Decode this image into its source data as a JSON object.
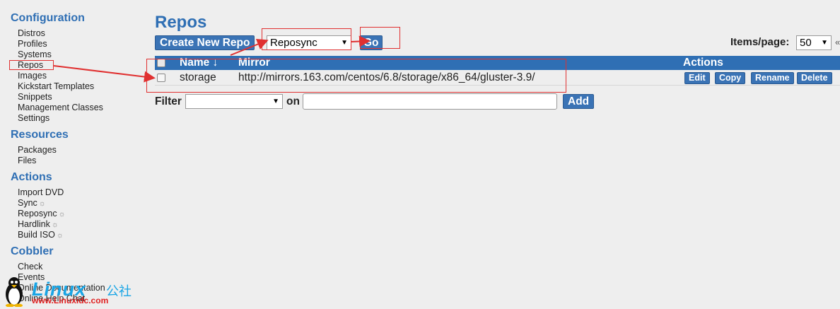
{
  "sidebar": {
    "configuration": {
      "heading": "Configuration",
      "items": [
        "Distros",
        "Profiles",
        "Systems",
        "Repos",
        "Images",
        "Kickstart Templates",
        "Snippets",
        "Management Classes",
        "Settings"
      ]
    },
    "resources": {
      "heading": "Resources",
      "items": [
        "Packages",
        "Files"
      ]
    },
    "actions": {
      "heading": "Actions",
      "items": [
        "Import DVD",
        "Sync",
        "Reposync",
        "Hardlink",
        "Build ISO"
      ],
      "gear_glyph": "☼"
    },
    "cobbler": {
      "heading": "Cobbler",
      "items": [
        "Check",
        "Events",
        "Online Documentation",
        "Online Help Chat"
      ]
    }
  },
  "main": {
    "title": "Repos",
    "create_button": "Create New Repo",
    "batch_action": {
      "selected": "Reposync"
    },
    "go_button": "Go",
    "items_per_page": {
      "label": "Items/page:",
      "selected": "50"
    },
    "table": {
      "headers": {
        "name": "Name ↓",
        "mirror": "Mirror",
        "actions": "Actions"
      },
      "rows": [
        {
          "name": "storage",
          "mirror": "http://mirrors.163.com/centos/6.8/storage/x86_64/gluster-3.9/",
          "actions": [
            "Edit",
            "Copy",
            "Rename",
            "Delete"
          ]
        }
      ]
    },
    "filter": {
      "label": "Filter",
      "selected": "",
      "on_label": "on",
      "input_value": "",
      "add_button": "Add"
    }
  },
  "watermark": {
    "brand": "Linux",
    "brand_cn": "公社",
    "url": "www.Linuxidc.com"
  },
  "colors": {
    "accent": "#2f6fb4",
    "button": "#3a73b5",
    "background": "#eeeeee",
    "annotation": "#e03030"
  }
}
